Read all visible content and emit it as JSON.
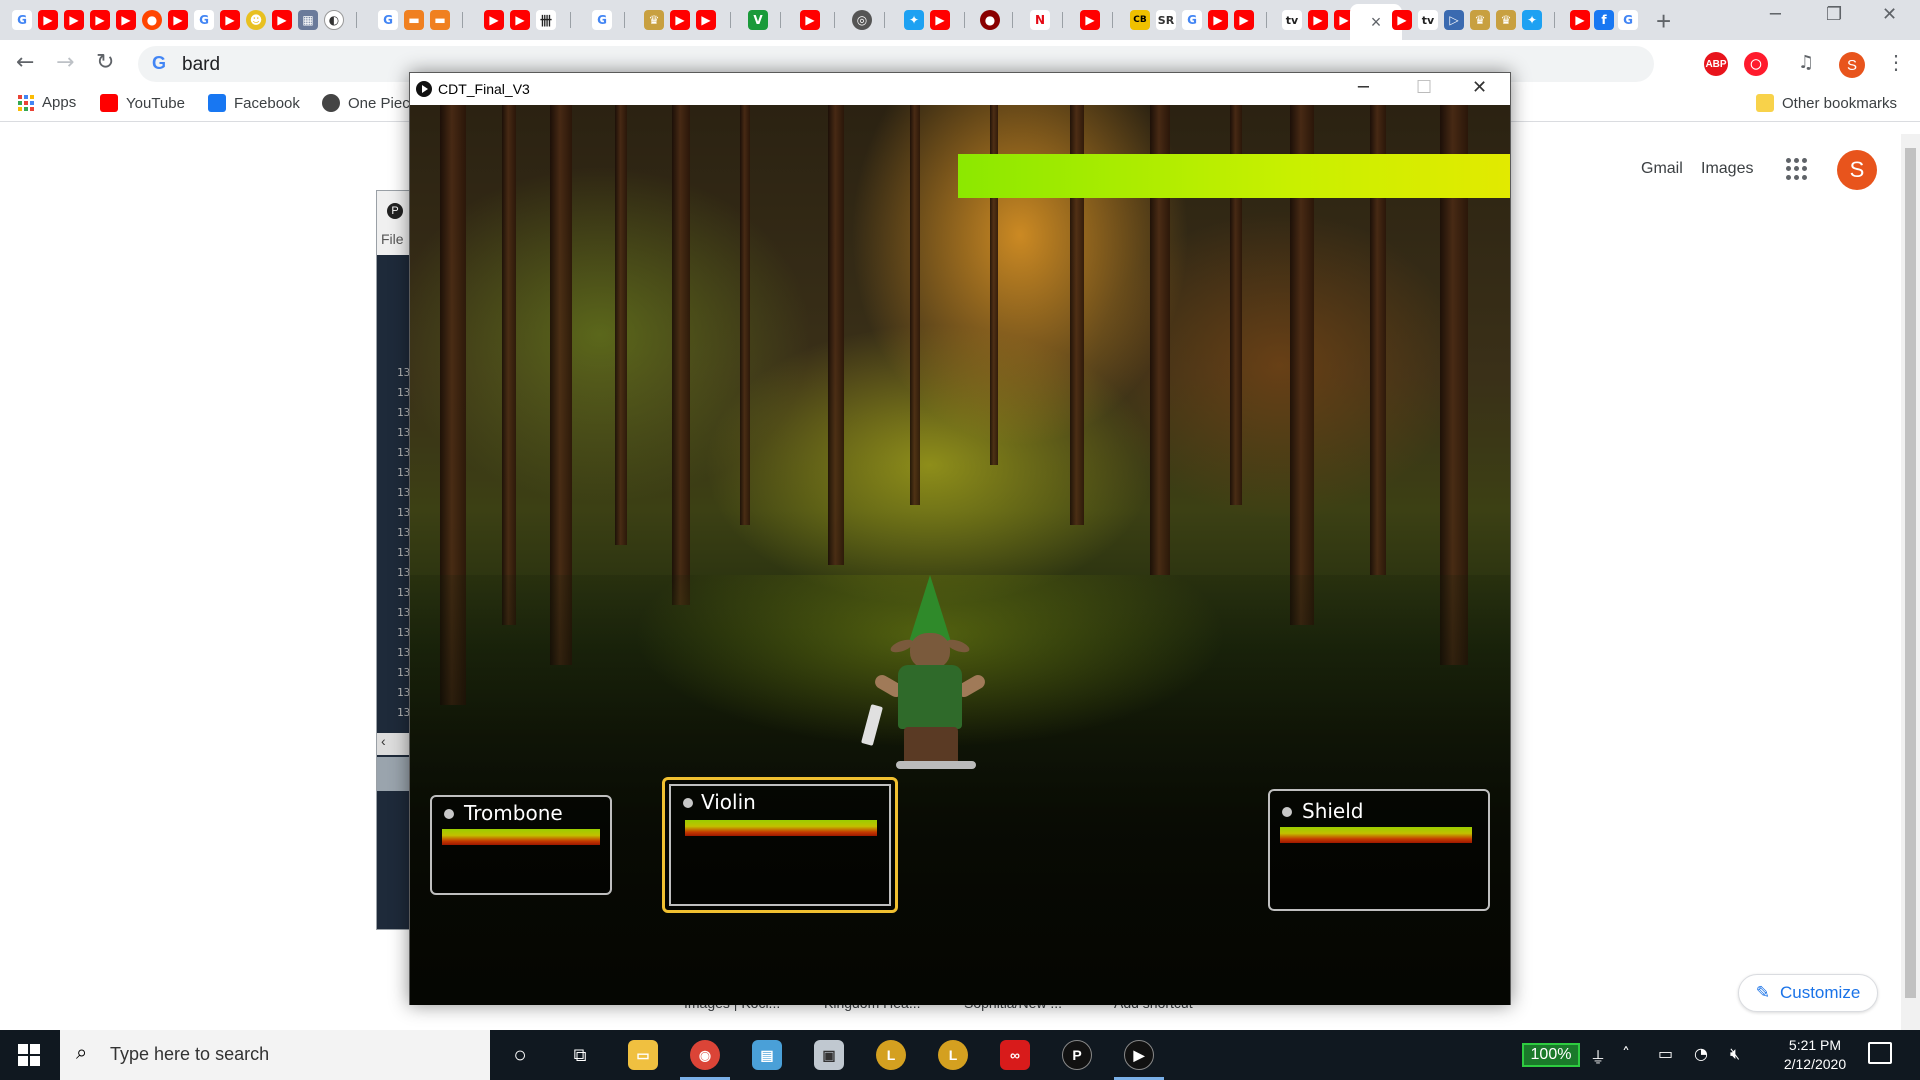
{
  "browser": {
    "address": "bard",
    "active_tab_close": "×",
    "new_tab": "+",
    "bookmarks": [
      {
        "label": "Apps",
        "color": "#ea4335"
      },
      {
        "label": "YouTube",
        "color": "#ff0000"
      },
      {
        "label": "Facebook",
        "color": "#1877f2"
      },
      {
        "label": "One Piec",
        "color": "#444444"
      }
    ],
    "other_bookmarks": "Other bookmarks",
    "profile_initial": "S"
  },
  "ntp": {
    "gmail": "Gmail",
    "images": "Images",
    "avatar_initial": "S",
    "customize": "Customize",
    "shortcuts": [
      "Images | Kocl...",
      "Kingdom Hea...",
      "Sophitia/New ...",
      "Add shortcut"
    ]
  },
  "ide": {
    "file_menu": "File",
    "line_prefix": "13"
  },
  "game": {
    "window_title": "CDT_Final_V3",
    "enemy_health_color": "#b8f000",
    "actions": [
      {
        "label": "Trombone",
        "selected": false
      },
      {
        "label": "Violin",
        "selected": true
      },
      {
        "label": "Shield",
        "selected": false
      }
    ]
  },
  "taskbar": {
    "search_placeholder": "Type here to search",
    "battery": "100%",
    "time": "5:21 PM",
    "date": "2/12/2020"
  }
}
